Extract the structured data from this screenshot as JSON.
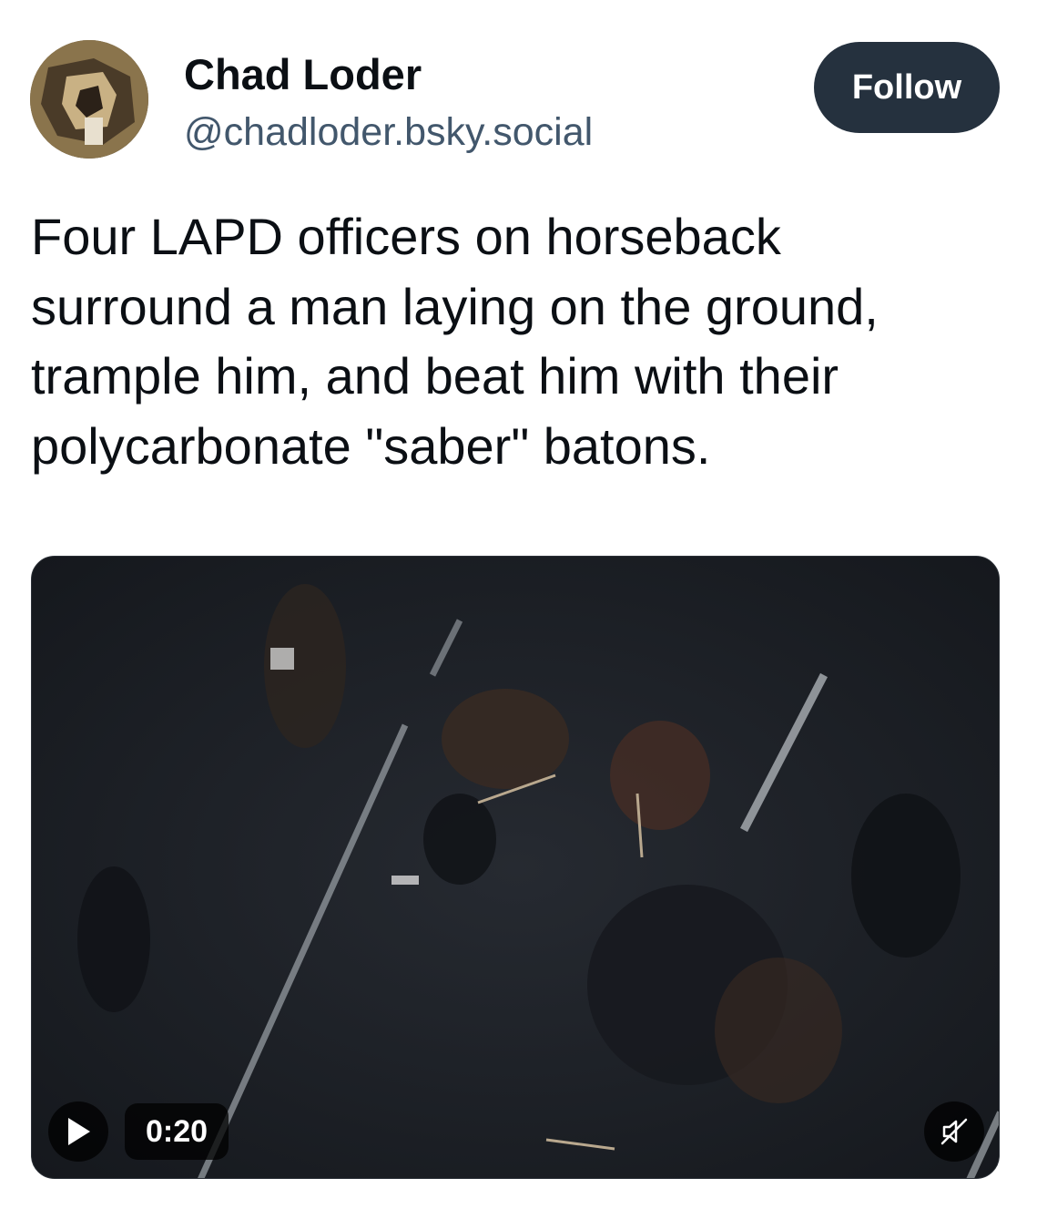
{
  "author": {
    "display_name": "Chad Loder",
    "handle": "@chadloder.bsky.social"
  },
  "follow_button": {
    "label": "Follow"
  },
  "post": {
    "text_lines": [
      "Four LAPD officers on horseback",
      "surround a man laying on the ground,",
      "trample him, and beat him with their",
      "polycarbonate \"saber\" batons."
    ]
  },
  "video": {
    "duration": "0:20",
    "play_icon": "play-icon",
    "mute_icon": "muted-speaker-icon"
  },
  "colors": {
    "follow_bg": "#25313e",
    "handle": "#42576c",
    "text": "#0b0f14"
  }
}
